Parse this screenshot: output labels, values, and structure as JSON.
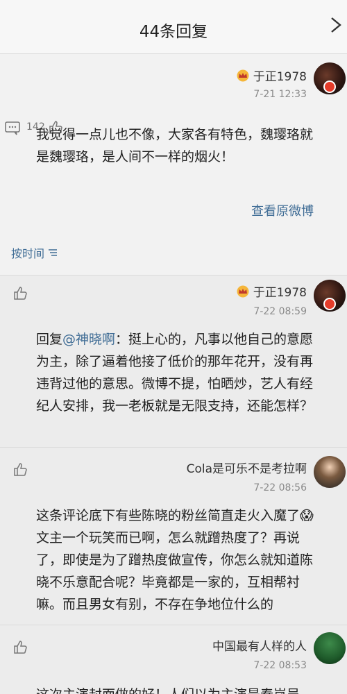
{
  "header": {
    "title": "44条回复"
  },
  "main_comment": {
    "user": "于正1978",
    "time": "7-21 12:33",
    "like_count": "142",
    "text": "我觉得一点儿也不像，大家各有特色，魏璎珞就是魏璎珞，是人间不一样的烟火！",
    "link_label": "查看原微博",
    "sort_label": "按时间"
  },
  "replies": [
    {
      "user": "于正1978",
      "time": "7-22 08:59",
      "text_prefix": "回复",
      "mention": "@神晓啊",
      "text": "：挺上心的，凡事以他自己的意愿为主，除了逼着他接了低价的那年花开，没有再违背过他的意思。微博不提，怕晒炒，艺人有经纪人安排，我一老板就是无限支持，还能怎样？"
    },
    {
      "user": "Cola是可乐不是考拉啊",
      "time": "7-22 08:56",
      "text": "这条评论底下有些陈晓的粉丝简直走火入魔了😱文主一个玩笑而已啊，怎么就蹭热度了？再说了，即使是为了蹭热度做宣传，你怎么就知道陈晓不乐意配合呢？毕竟都是一家的，互相帮衬嘛。而且男女有别，不存在争地位什么的"
    },
    {
      "user": "中国最有人样的人",
      "time": "7-22 08:53",
      "text": "这次主演封面做的好！人们以为主演是秦岚吴"
    }
  ]
}
